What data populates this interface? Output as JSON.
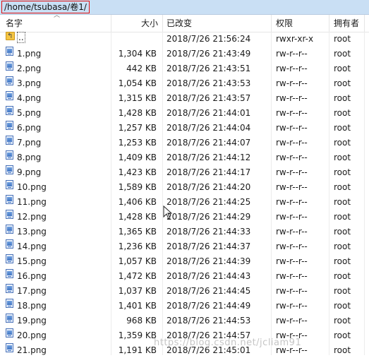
{
  "path": "/home/tsubasa/卷1/",
  "columns": {
    "name": "名字",
    "size": "大小",
    "modified": "已改变",
    "permissions": "权限",
    "owner": "拥有者"
  },
  "parent_row": {
    "name": "..",
    "modified": "2018/7/26 21:56:24",
    "permissions": "rwxr-xr-x",
    "owner": "root"
  },
  "files": [
    {
      "name": "1.png",
      "size": "1,304 KB",
      "modified": "2018/7/26 21:43:49",
      "permissions": "rw-r--r--",
      "owner": "root"
    },
    {
      "name": "2.png",
      "size": "442 KB",
      "modified": "2018/7/26 21:43:51",
      "permissions": "rw-r--r--",
      "owner": "root"
    },
    {
      "name": "3.png",
      "size": "1,054 KB",
      "modified": "2018/7/26 21:43:53",
      "permissions": "rw-r--r--",
      "owner": "root"
    },
    {
      "name": "4.png",
      "size": "1,315 KB",
      "modified": "2018/7/26 21:43:57",
      "permissions": "rw-r--r--",
      "owner": "root"
    },
    {
      "name": "5.png",
      "size": "1,428 KB",
      "modified": "2018/7/26 21:44:01",
      "permissions": "rw-r--r--",
      "owner": "root"
    },
    {
      "name": "6.png",
      "size": "1,257 KB",
      "modified": "2018/7/26 21:44:04",
      "permissions": "rw-r--r--",
      "owner": "root"
    },
    {
      "name": "7.png",
      "size": "1,253 KB",
      "modified": "2018/7/26 21:44:07",
      "permissions": "rw-r--r--",
      "owner": "root"
    },
    {
      "name": "8.png",
      "size": "1,409 KB",
      "modified": "2018/7/26 21:44:12",
      "permissions": "rw-r--r--",
      "owner": "root"
    },
    {
      "name": "9.png",
      "size": "1,423 KB",
      "modified": "2018/7/26 21:44:17",
      "permissions": "rw-r--r--",
      "owner": "root"
    },
    {
      "name": "10.png",
      "size": "1,589 KB",
      "modified": "2018/7/26 21:44:20",
      "permissions": "rw-r--r--",
      "owner": "root"
    },
    {
      "name": "11.png",
      "size": "1,406 KB",
      "modified": "2018/7/26 21:44:25",
      "permissions": "rw-r--r--",
      "owner": "root"
    },
    {
      "name": "12.png",
      "size": "1,428 KB",
      "modified": "2018/7/26 21:44:29",
      "permissions": "rw-r--r--",
      "owner": "root"
    },
    {
      "name": "13.png",
      "size": "1,365 KB",
      "modified": "2018/7/26 21:44:33",
      "permissions": "rw-r--r--",
      "owner": "root"
    },
    {
      "name": "14.png",
      "size": "1,236 KB",
      "modified": "2018/7/26 21:44:37",
      "permissions": "rw-r--r--",
      "owner": "root"
    },
    {
      "name": "15.png",
      "size": "1,057 KB",
      "modified": "2018/7/26 21:44:39",
      "permissions": "rw-r--r--",
      "owner": "root"
    },
    {
      "name": "16.png",
      "size": "1,472 KB",
      "modified": "2018/7/26 21:44:43",
      "permissions": "rw-r--r--",
      "owner": "root"
    },
    {
      "name": "17.png",
      "size": "1,037 KB",
      "modified": "2018/7/26 21:44:45",
      "permissions": "rw-r--r--",
      "owner": "root"
    },
    {
      "name": "18.png",
      "size": "1,401 KB",
      "modified": "2018/7/26 21:44:49",
      "permissions": "rw-r--r--",
      "owner": "root"
    },
    {
      "name": "19.png",
      "size": "968 KB",
      "modified": "2018/7/26 21:44:53",
      "permissions": "rw-r--r--",
      "owner": "root"
    },
    {
      "name": "20.png",
      "size": "1,359 KB",
      "modified": "2018/7/26 21:44:57",
      "permissions": "rw-r--r--",
      "owner": "root"
    },
    {
      "name": "21.png",
      "size": "1,191 KB",
      "modified": "2018/7/26 21:45:01",
      "permissions": "rw-r--r--",
      "owner": "root"
    }
  ],
  "watermark": "https://blog.csdn.net/jcliam91",
  "icons": {
    "sort": "sort-up-arrow-icon",
    "parent": "parent-folder-icon",
    "file": "image-file-icon",
    "cursor": "mouse-pointer-icon"
  }
}
